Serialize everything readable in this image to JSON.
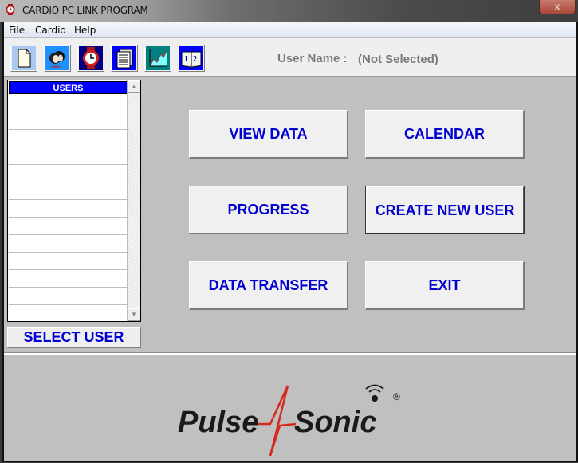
{
  "window": {
    "title": "CARDIO PC LINK PROGRAM",
    "close_glyph": "x"
  },
  "menu": {
    "items": [
      "File",
      "Cardio",
      "Help"
    ]
  },
  "toolbar": {
    "buttons": [
      {
        "name": "new-document",
        "icon": "document-icon",
        "bg": "#a8c8f0"
      },
      {
        "name": "users",
        "icon": "users-faces-icon",
        "bg": "#1e90ff"
      },
      {
        "name": "watch",
        "icon": "watch-icon",
        "bg": "#000080"
      },
      {
        "name": "data-table",
        "icon": "table-icon",
        "bg": "#0000ff"
      },
      {
        "name": "progress-chart",
        "icon": "chart-icon",
        "bg": "#008080"
      },
      {
        "name": "calendar-book",
        "icon": "book-icon",
        "bg": "#0000ff"
      }
    ],
    "user_name_label": "User Name :",
    "user_name_value": "(Not Selected)"
  },
  "user_list": {
    "header": "USERS",
    "rows": [
      "",
      "",
      "",
      "",
      "",
      "",
      "",
      "",
      "",
      "",
      "",
      "",
      ""
    ],
    "scroll_up": "▲",
    "scroll_down": "▼"
  },
  "select_user_label": "SELECT USER",
  "actions": {
    "view_data": "VIEW DATA",
    "calendar": "CALENDAR",
    "progress": "PROGRESS",
    "create_new_user": "CREATE NEW USER",
    "data_transfer": "DATA TRANSFER",
    "exit": "EXIT"
  },
  "logo": {
    "left_text": "Pulse",
    "right_text": "Sonic",
    "registered": "®",
    "accent_color": "#d42a1e"
  }
}
